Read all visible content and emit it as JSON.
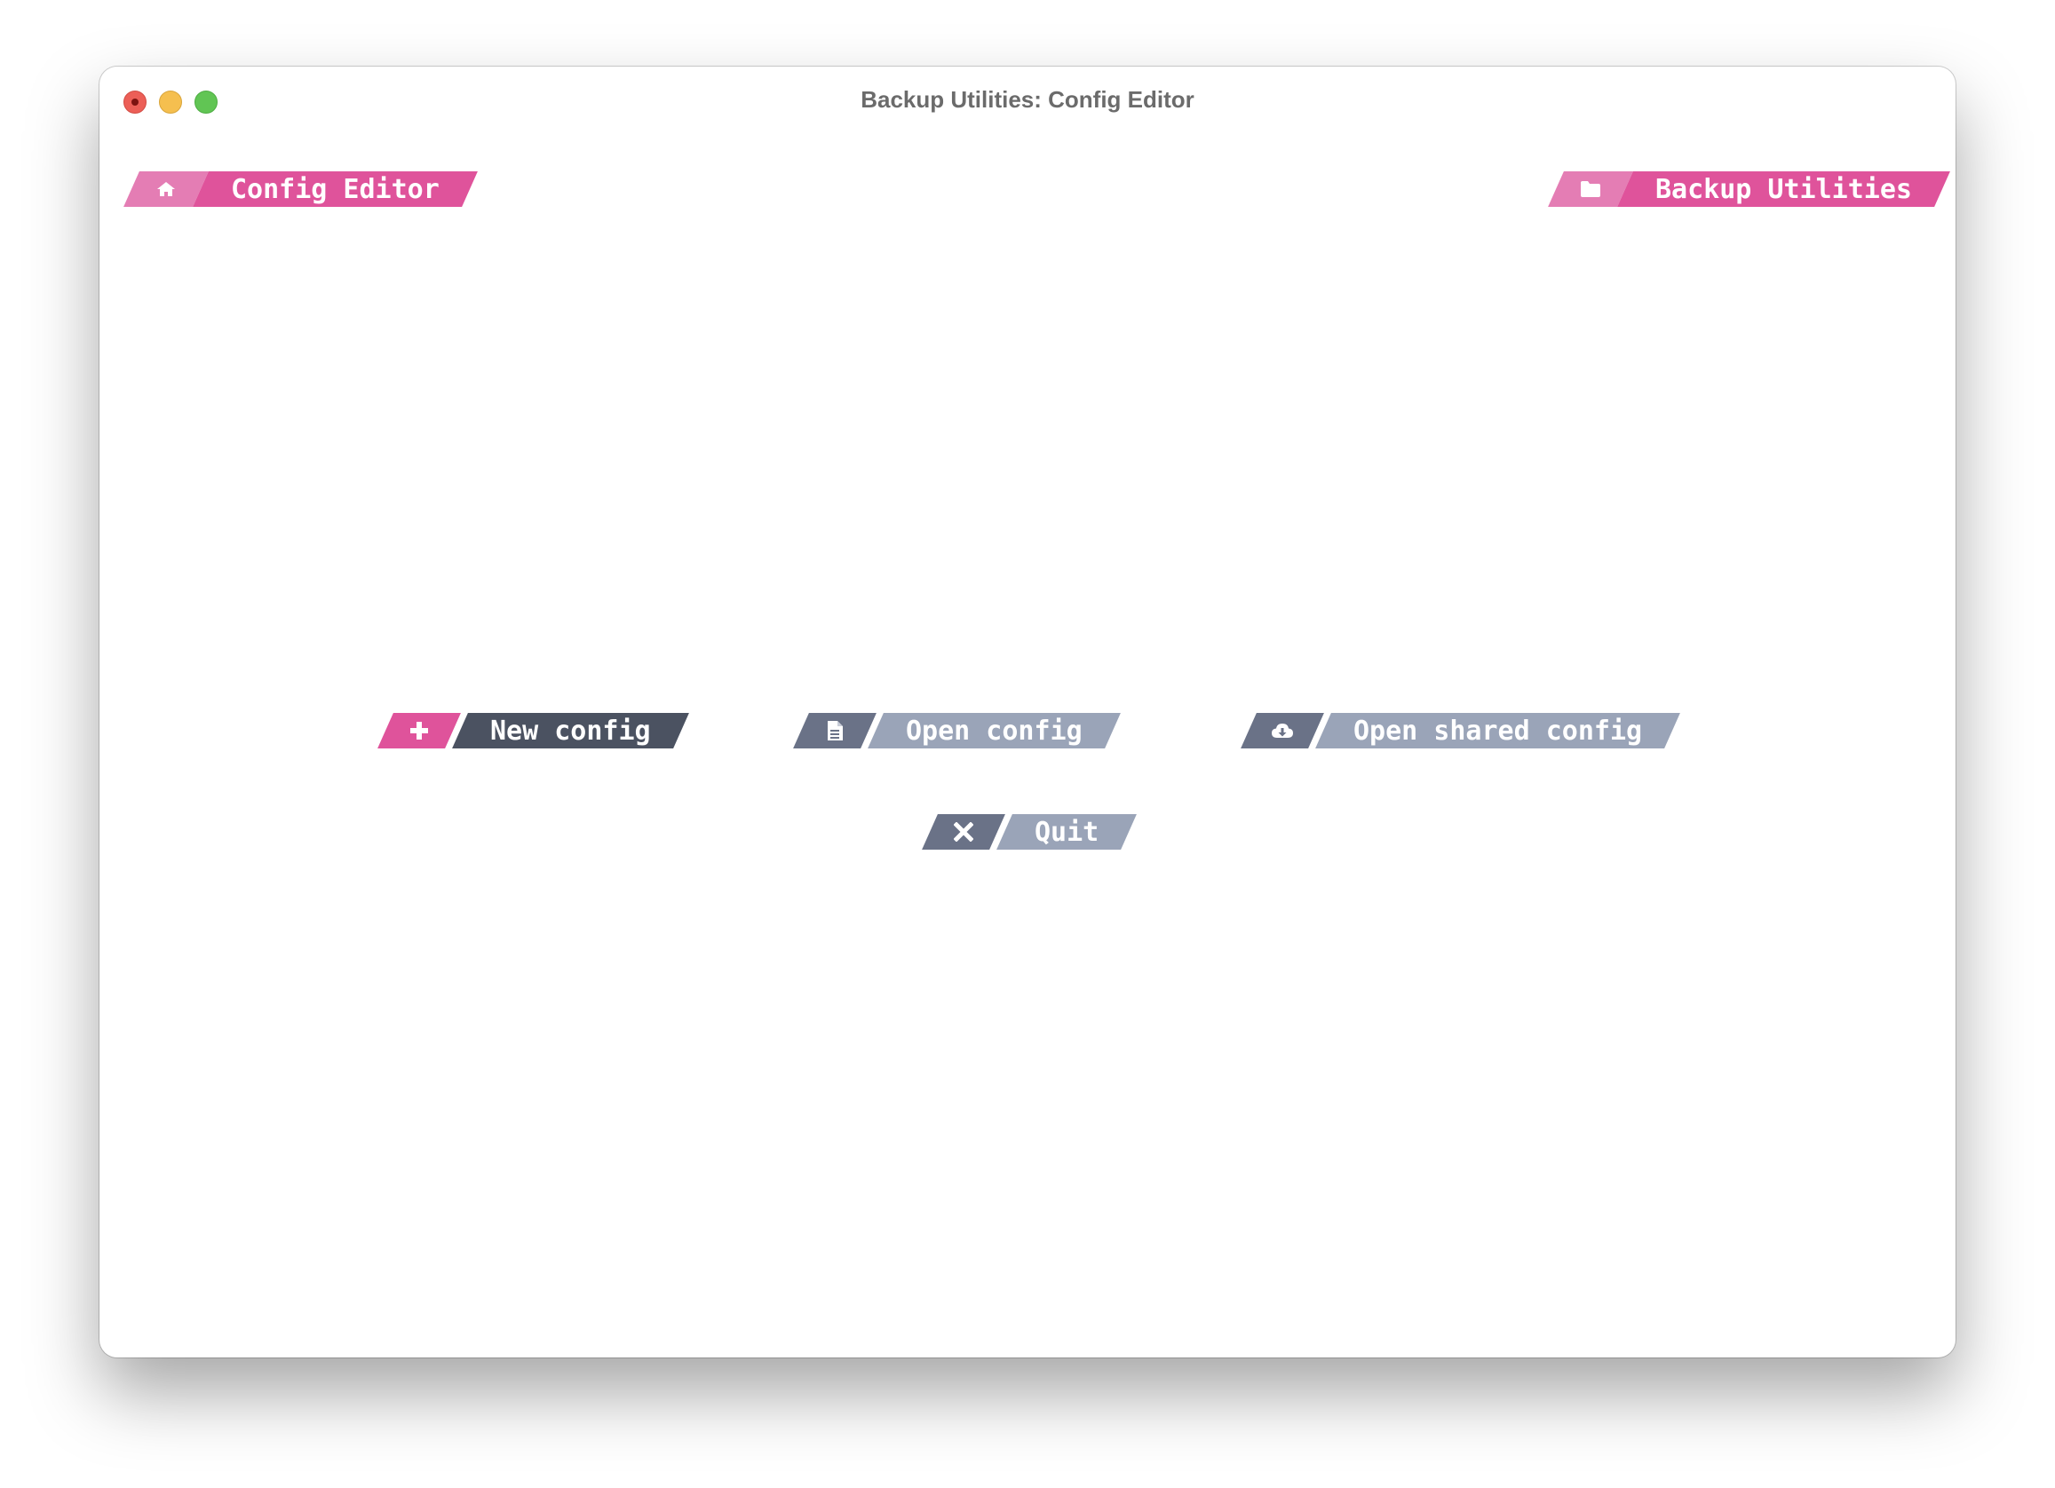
{
  "window": {
    "title": "Backup Utilities: Config Editor"
  },
  "header": {
    "left_label": "Config Editor",
    "left_icon": "home-icon",
    "right_label": "Backup Utilities",
    "right_icon": "folder-icon"
  },
  "menu": {
    "new_config": "New config",
    "new_config_icon": "plus-icon",
    "open_config": "Open config",
    "open_config_icon": "file-icon",
    "open_shared_config": "Open shared config",
    "open_shared_config_icon": "cloud-download-icon",
    "quit": "Quit",
    "quit_icon": "close-icon"
  },
  "colors": {
    "pink": "#df539b",
    "pink_light": "#e47db4",
    "dark": "#4b5261",
    "slate": "#6a7287",
    "pale": "#9aa4b8"
  }
}
